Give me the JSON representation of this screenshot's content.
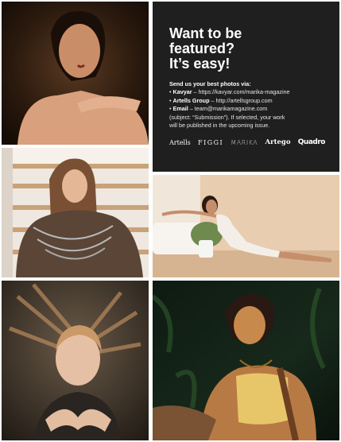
{
  "panel": {
    "heading_lines": [
      "Want to be",
      "featured?",
      "It’s easy!"
    ],
    "intro": "Send us your best photos via:",
    "items": [
      {
        "bullet": "•",
        "name": "Kavyar",
        "detail": "– https://kavyar.com/marika-magazine"
      },
      {
        "bullet": "•",
        "name": "Artells Group",
        "detail": "– http://artellsgroup.com"
      },
      {
        "bullet": "•",
        "name": "Email",
        "detail": "– team@marikamagazine.com"
      }
    ],
    "note_lines": [
      "(subject: “Submission”). If selected, your work",
      "will be published in the upcoming issue."
    ],
    "logos": [
      "Artells",
      "FIGGI",
      "MARIKA",
      "Artego",
      "Quadro"
    ]
  },
  "colors": {
    "panel_background": "#1f1f1f",
    "page_background": "#ffffff",
    "text": "#ffffff"
  }
}
